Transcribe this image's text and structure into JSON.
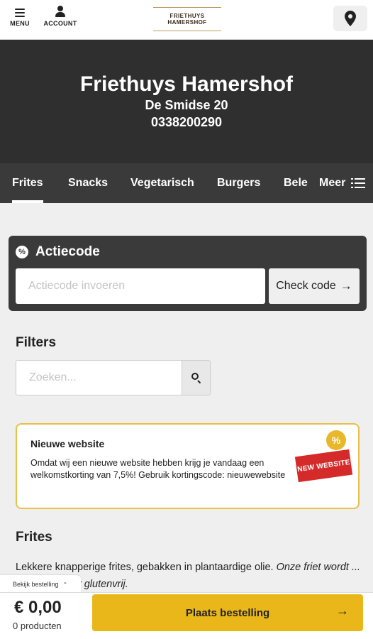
{
  "header": {
    "menu_label": "MENU",
    "account_label": "ACCOUNT",
    "logo_line1": "FRIETHUYS",
    "logo_line2": "HAMERSHOF",
    "location_icon": "map-pin-icon"
  },
  "hero": {
    "name": "Friethuys Hamershof",
    "address": "De Smidse 20",
    "phone": "0338200290"
  },
  "categories": {
    "items": [
      "Frites",
      "Snacks",
      "Vegetarisch",
      "Burgers",
      "Bele"
    ],
    "active": "Frites",
    "more_label": "Meer"
  },
  "actiecode": {
    "title": "Actiecode",
    "icon": "%",
    "placeholder": "Actiecode invoeren",
    "button_label": "Check code",
    "button_arrow": "→"
  },
  "filters": {
    "title": "Filters",
    "search_placeholder": "Zoeken..."
  },
  "promo": {
    "title": "Nieuwe website",
    "text": "Omdat wij een nieuwe website hebben krijg je vandaag een welkomstkorting van 7,5%! Gebruik kortingscode: nieuwewebsite",
    "badge": "%",
    "stamp": "NEW WEBSITE",
    "accent": "#e8c04a"
  },
  "section": {
    "title": "Frites",
    "desc_plain": "Lekkere knapperige frites, gebakken in plantaardige olie. ",
    "desc_italic": "Onze friet wordt ... en is daardoor glutenvrij."
  },
  "cart": {
    "view_label": "Bekijk bestelling",
    "chevron": "⌃",
    "total": "€ 0,00",
    "count": "0 producten",
    "order_label": "Plaats bestelling",
    "order_arrow": "→",
    "accent": "#eab71a"
  }
}
